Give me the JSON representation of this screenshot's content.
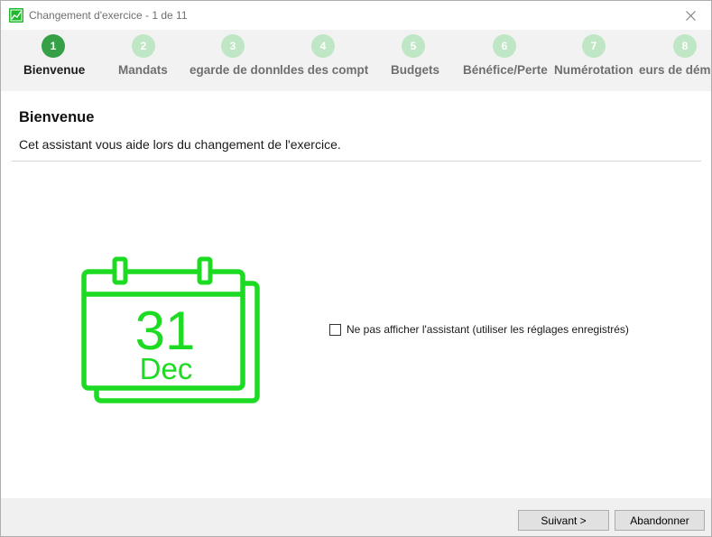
{
  "window": {
    "title": "Changement d'exercice - 1 de 11",
    "close_symbol": "×"
  },
  "steps": [
    {
      "number": "1",
      "label": "Bienvenue",
      "active": true
    },
    {
      "number": "2",
      "label": "Mandats",
      "active": false
    },
    {
      "number": "3",
      "label": "egarde de donnée",
      "active": false
    },
    {
      "number": "4",
      "label": "ldes des compt",
      "active": false
    },
    {
      "number": "5",
      "label": "Budgets",
      "active": false
    },
    {
      "number": "6",
      "label": "Bénéfice/Perte",
      "active": false
    },
    {
      "number": "7",
      "label": "Numérotation",
      "active": false
    },
    {
      "number": "8",
      "label": "eurs de dém",
      "active": false
    }
  ],
  "main": {
    "title": "Bienvenue",
    "description": "Cet assistant vous aide lors du changement de l'exercice.",
    "calendar": {
      "day": "31",
      "month": "Dec",
      "color": "#1ddb22"
    },
    "checkbox_label": "Ne pas afficher l'assistant (utiliser les réglages enregistrés)",
    "checkbox_checked": false
  },
  "footer": {
    "next_label": "Suivant >",
    "cancel_label": "Abandonner"
  },
  "colors": {
    "active_step": "#35a046",
    "inactive_step": "#bfe6c5",
    "accent_green": "#1ddb22"
  }
}
